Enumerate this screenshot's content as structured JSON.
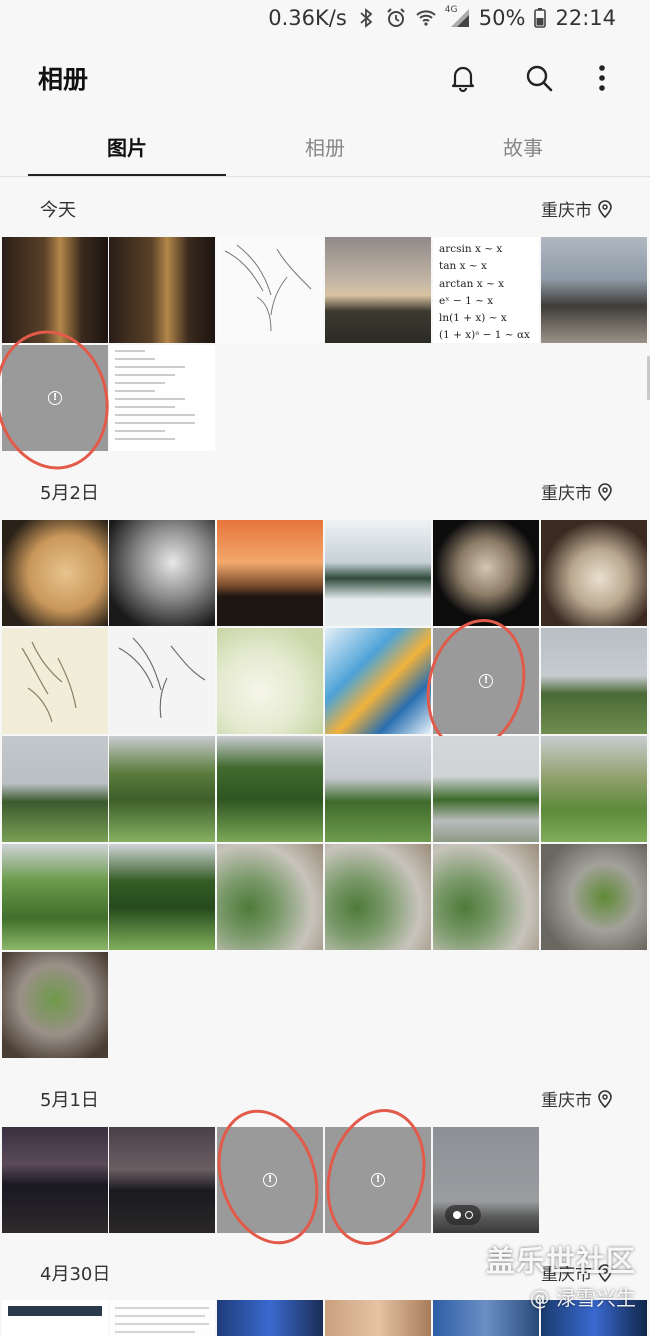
{
  "status_bar": {
    "net_speed": "0.36K/s",
    "signal_label": "4G",
    "battery": "50%",
    "time": "22:14"
  },
  "app_bar": {
    "title": "相册"
  },
  "tabs": [
    {
      "label": "图片",
      "active": true
    },
    {
      "label": "相册",
      "active": false
    },
    {
      "label": "故事",
      "active": false
    }
  ],
  "sections": [
    {
      "date": "今天",
      "location": "重庆市"
    },
    {
      "date": "5月2日",
      "location": "重庆市"
    },
    {
      "date": "5月1日",
      "location": "重庆市"
    },
    {
      "date": "4月30日",
      "location": "重庆市"
    }
  ],
  "math_note": {
    "lines": [
      "arcsin x ~ x",
      "tan x ~ x",
      "arctan x ~ x",
      "eˣ − 1 ~ x",
      "ln(1 + x) ~ x",
      "(1 + x)ᵃ − 1 ~ αx"
    ]
  },
  "watermark": {
    "line1": "盖乐世社区",
    "line2": "@ 渌雪兴生"
  },
  "colors": {
    "accent_circle": "#e25a4a",
    "error_thumb": "#9a9a9a",
    "background": "#f7f7f7"
  }
}
